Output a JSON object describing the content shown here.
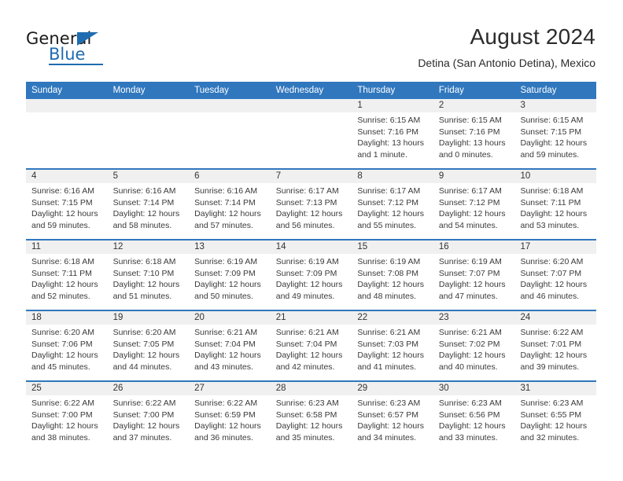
{
  "brand": {
    "name_top": "General",
    "name_bottom": "Blue",
    "accent_color": "#1f6cb0"
  },
  "header": {
    "title": "August 2024",
    "subtitle": "Detina (San Antonio Detina), Mexico",
    "header_bg_color": "#3077be",
    "daynum_bg_color": "#f0f0f0"
  },
  "calendar": {
    "weekdays": [
      "Sunday",
      "Monday",
      "Tuesday",
      "Wednesday",
      "Thursday",
      "Friday",
      "Saturday"
    ],
    "weeks": [
      [
        {
          "day": "",
          "sunrise": "",
          "sunset": "",
          "daylight": ""
        },
        {
          "day": "",
          "sunrise": "",
          "sunset": "",
          "daylight": ""
        },
        {
          "day": "",
          "sunrise": "",
          "sunset": "",
          "daylight": ""
        },
        {
          "day": "",
          "sunrise": "",
          "sunset": "",
          "daylight": ""
        },
        {
          "day": "1",
          "sunrise": "Sunrise: 6:15 AM",
          "sunset": "Sunset: 7:16 PM",
          "daylight": "Daylight: 13 hours and 1 minute."
        },
        {
          "day": "2",
          "sunrise": "Sunrise: 6:15 AM",
          "sunset": "Sunset: 7:16 PM",
          "daylight": "Daylight: 13 hours and 0 minutes."
        },
        {
          "day": "3",
          "sunrise": "Sunrise: 6:15 AM",
          "sunset": "Sunset: 7:15 PM",
          "daylight": "Daylight: 12 hours and 59 minutes."
        }
      ],
      [
        {
          "day": "4",
          "sunrise": "Sunrise: 6:16 AM",
          "sunset": "Sunset: 7:15 PM",
          "daylight": "Daylight: 12 hours and 59 minutes."
        },
        {
          "day": "5",
          "sunrise": "Sunrise: 6:16 AM",
          "sunset": "Sunset: 7:14 PM",
          "daylight": "Daylight: 12 hours and 58 minutes."
        },
        {
          "day": "6",
          "sunrise": "Sunrise: 6:16 AM",
          "sunset": "Sunset: 7:14 PM",
          "daylight": "Daylight: 12 hours and 57 minutes."
        },
        {
          "day": "7",
          "sunrise": "Sunrise: 6:17 AM",
          "sunset": "Sunset: 7:13 PM",
          "daylight": "Daylight: 12 hours and 56 minutes."
        },
        {
          "day": "8",
          "sunrise": "Sunrise: 6:17 AM",
          "sunset": "Sunset: 7:12 PM",
          "daylight": "Daylight: 12 hours and 55 minutes."
        },
        {
          "day": "9",
          "sunrise": "Sunrise: 6:17 AM",
          "sunset": "Sunset: 7:12 PM",
          "daylight": "Daylight: 12 hours and 54 minutes."
        },
        {
          "day": "10",
          "sunrise": "Sunrise: 6:18 AM",
          "sunset": "Sunset: 7:11 PM",
          "daylight": "Daylight: 12 hours and 53 minutes."
        }
      ],
      [
        {
          "day": "11",
          "sunrise": "Sunrise: 6:18 AM",
          "sunset": "Sunset: 7:11 PM",
          "daylight": "Daylight: 12 hours and 52 minutes."
        },
        {
          "day": "12",
          "sunrise": "Sunrise: 6:18 AM",
          "sunset": "Sunset: 7:10 PM",
          "daylight": "Daylight: 12 hours and 51 minutes."
        },
        {
          "day": "13",
          "sunrise": "Sunrise: 6:19 AM",
          "sunset": "Sunset: 7:09 PM",
          "daylight": "Daylight: 12 hours and 50 minutes."
        },
        {
          "day": "14",
          "sunrise": "Sunrise: 6:19 AM",
          "sunset": "Sunset: 7:09 PM",
          "daylight": "Daylight: 12 hours and 49 minutes."
        },
        {
          "day": "15",
          "sunrise": "Sunrise: 6:19 AM",
          "sunset": "Sunset: 7:08 PM",
          "daylight": "Daylight: 12 hours and 48 minutes."
        },
        {
          "day": "16",
          "sunrise": "Sunrise: 6:19 AM",
          "sunset": "Sunset: 7:07 PM",
          "daylight": "Daylight: 12 hours and 47 minutes."
        },
        {
          "day": "17",
          "sunrise": "Sunrise: 6:20 AM",
          "sunset": "Sunset: 7:07 PM",
          "daylight": "Daylight: 12 hours and 46 minutes."
        }
      ],
      [
        {
          "day": "18",
          "sunrise": "Sunrise: 6:20 AM",
          "sunset": "Sunset: 7:06 PM",
          "daylight": "Daylight: 12 hours and 45 minutes."
        },
        {
          "day": "19",
          "sunrise": "Sunrise: 6:20 AM",
          "sunset": "Sunset: 7:05 PM",
          "daylight": "Daylight: 12 hours and 44 minutes."
        },
        {
          "day": "20",
          "sunrise": "Sunrise: 6:21 AM",
          "sunset": "Sunset: 7:04 PM",
          "daylight": "Daylight: 12 hours and 43 minutes."
        },
        {
          "day": "21",
          "sunrise": "Sunrise: 6:21 AM",
          "sunset": "Sunset: 7:04 PM",
          "daylight": "Daylight: 12 hours and 42 minutes."
        },
        {
          "day": "22",
          "sunrise": "Sunrise: 6:21 AM",
          "sunset": "Sunset: 7:03 PM",
          "daylight": "Daylight: 12 hours and 41 minutes."
        },
        {
          "day": "23",
          "sunrise": "Sunrise: 6:21 AM",
          "sunset": "Sunset: 7:02 PM",
          "daylight": "Daylight: 12 hours and 40 minutes."
        },
        {
          "day": "24",
          "sunrise": "Sunrise: 6:22 AM",
          "sunset": "Sunset: 7:01 PM",
          "daylight": "Daylight: 12 hours and 39 minutes."
        }
      ],
      [
        {
          "day": "25",
          "sunrise": "Sunrise: 6:22 AM",
          "sunset": "Sunset: 7:00 PM",
          "daylight": "Daylight: 12 hours and 38 minutes."
        },
        {
          "day": "26",
          "sunrise": "Sunrise: 6:22 AM",
          "sunset": "Sunset: 7:00 PM",
          "daylight": "Daylight: 12 hours and 37 minutes."
        },
        {
          "day": "27",
          "sunrise": "Sunrise: 6:22 AM",
          "sunset": "Sunset: 6:59 PM",
          "daylight": "Daylight: 12 hours and 36 minutes."
        },
        {
          "day": "28",
          "sunrise": "Sunrise: 6:23 AM",
          "sunset": "Sunset: 6:58 PM",
          "daylight": "Daylight: 12 hours and 35 minutes."
        },
        {
          "day": "29",
          "sunrise": "Sunrise: 6:23 AM",
          "sunset": "Sunset: 6:57 PM",
          "daylight": "Daylight: 12 hours and 34 minutes."
        },
        {
          "day": "30",
          "sunrise": "Sunrise: 6:23 AM",
          "sunset": "Sunset: 6:56 PM",
          "daylight": "Daylight: 12 hours and 33 minutes."
        },
        {
          "day": "31",
          "sunrise": "Sunrise: 6:23 AM",
          "sunset": "Sunset: 6:55 PM",
          "daylight": "Daylight: 12 hours and 32 minutes."
        }
      ]
    ]
  }
}
